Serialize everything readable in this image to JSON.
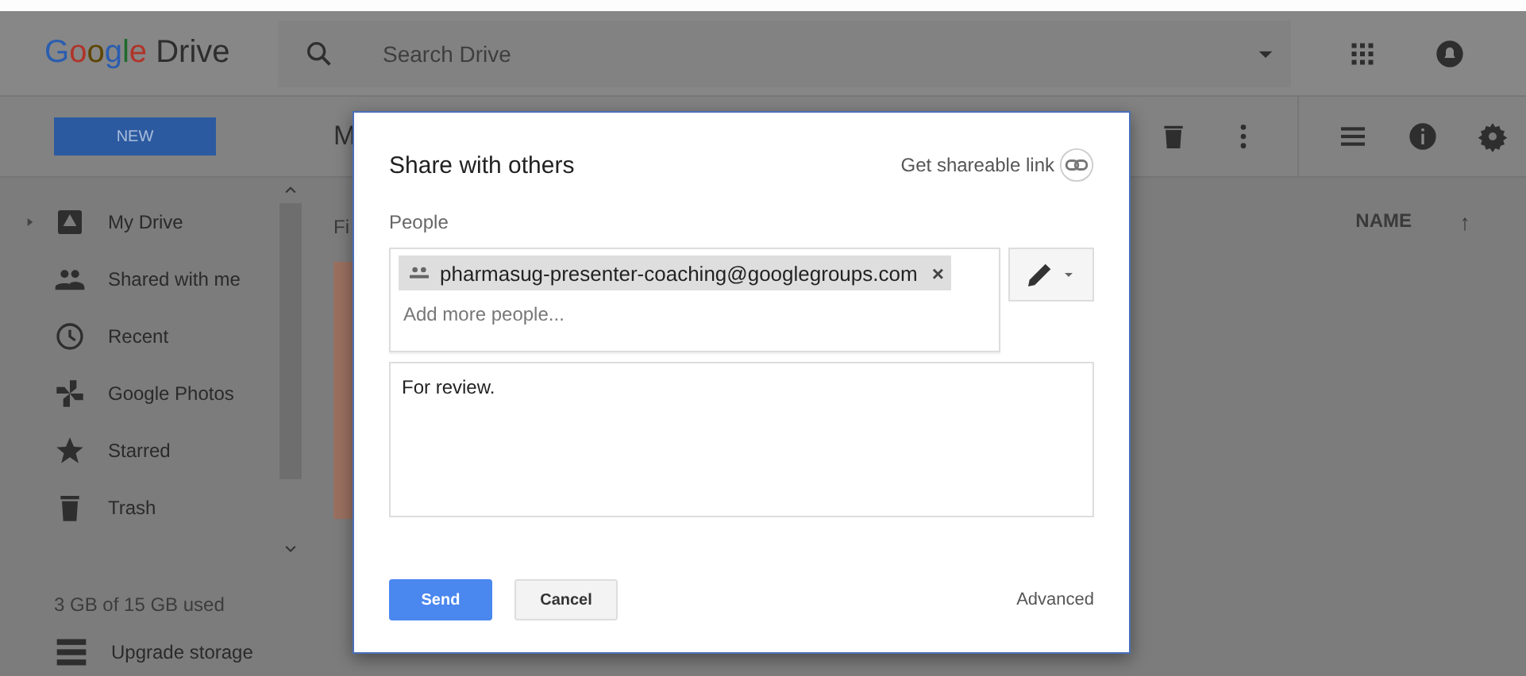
{
  "app": {
    "logo": "Google Drive",
    "search": {
      "placeholder": "Search Drive"
    }
  },
  "toolbar": {
    "new_button": "NEW",
    "breadcrumb": "M"
  },
  "sidebar": {
    "items": [
      {
        "label": "My Drive"
      },
      {
        "label": "Shared with me"
      },
      {
        "label": "Recent"
      },
      {
        "label": "Google Photos"
      },
      {
        "label": "Starred"
      },
      {
        "label": "Trash"
      }
    ],
    "storage": "3 GB of 15 GB used",
    "upgrade": "Upgrade storage"
  },
  "content": {
    "section_heading": "Fi",
    "name_column": "NAME",
    "sort_arrow": "↑"
  },
  "dialog": {
    "title": "Share with others",
    "shareable_link": "Get shareable link",
    "people_label": "People",
    "recipients": [
      {
        "email": "pharmasug-presenter-coaching@googlegroups.com",
        "remove": "×"
      }
    ],
    "add_people": {
      "placeholder": "Add more people..."
    },
    "message": "For review.",
    "buttons": [
      {
        "label": "Send",
        "kind": "primary"
      },
      {
        "label": "Cancel",
        "kind": "secondary"
      }
    ],
    "advanced": "Advanced"
  }
}
